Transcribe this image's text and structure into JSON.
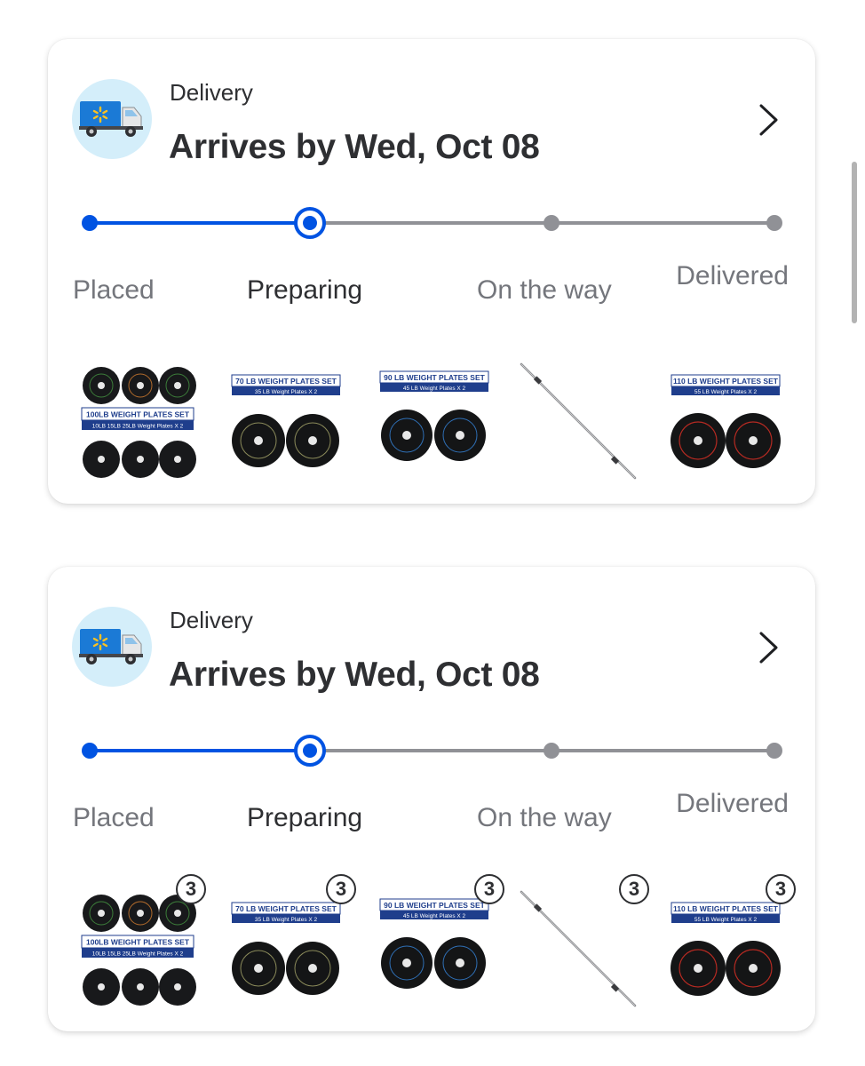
{
  "orders": [
    {
      "delivery_label": "Delivery",
      "arrival": "Arrives by Wed, Oct 08",
      "steps": [
        "Placed",
        "Preparing",
        "On the way",
        "Delivered"
      ],
      "current_step": 2,
      "items": [
        {
          "banner": "100LB WEIGHT PLATES SET",
          "sub": "10LB 15LB 25LB Weight Plates X 2",
          "quantity": ""
        },
        {
          "banner": "70 LB WEIGHT PLATES SET",
          "sub": "35 LB Weight Plates X 2",
          "quantity": ""
        },
        {
          "banner": "90 LB WEIGHT PLATES SET",
          "sub": "45 LB Weight Plates X 2",
          "quantity": ""
        },
        {
          "banner": "",
          "sub": "",
          "quantity": ""
        },
        {
          "banner": "110 LB WEIGHT PLATES SET",
          "sub": "55 LB Weight Plates X 2",
          "quantity": ""
        }
      ]
    },
    {
      "delivery_label": "Delivery",
      "arrival": "Arrives by Wed, Oct 08",
      "steps": [
        "Placed",
        "Preparing",
        "On the way",
        "Delivered"
      ],
      "current_step": 2,
      "items": [
        {
          "banner": "100LB WEIGHT PLATES SET",
          "sub": "10LB 15LB 25LB Weight Plates X 2",
          "quantity": "3"
        },
        {
          "banner": "70 LB WEIGHT PLATES SET",
          "sub": "35 LB Weight Plates X 2",
          "quantity": "3"
        },
        {
          "banner": "90 LB WEIGHT PLATES SET",
          "sub": "45 LB Weight Plates X 2",
          "quantity": "3"
        },
        {
          "banner": "",
          "sub": "",
          "quantity": "3"
        },
        {
          "banner": "110 LB WEIGHT PLATES SET",
          "sub": "55 LB Weight Plates X 2",
          "quantity": "3"
        }
      ]
    }
  ],
  "colors": {
    "accent": "#0053e2",
    "inactive": "#909196",
    "truck_bg": "#d4eefa",
    "text": "#2e2f32",
    "muted": "#74767c"
  },
  "icons": {
    "truck": "walmart-delivery-truck-icon",
    "chevron": "chevron-right-icon"
  }
}
